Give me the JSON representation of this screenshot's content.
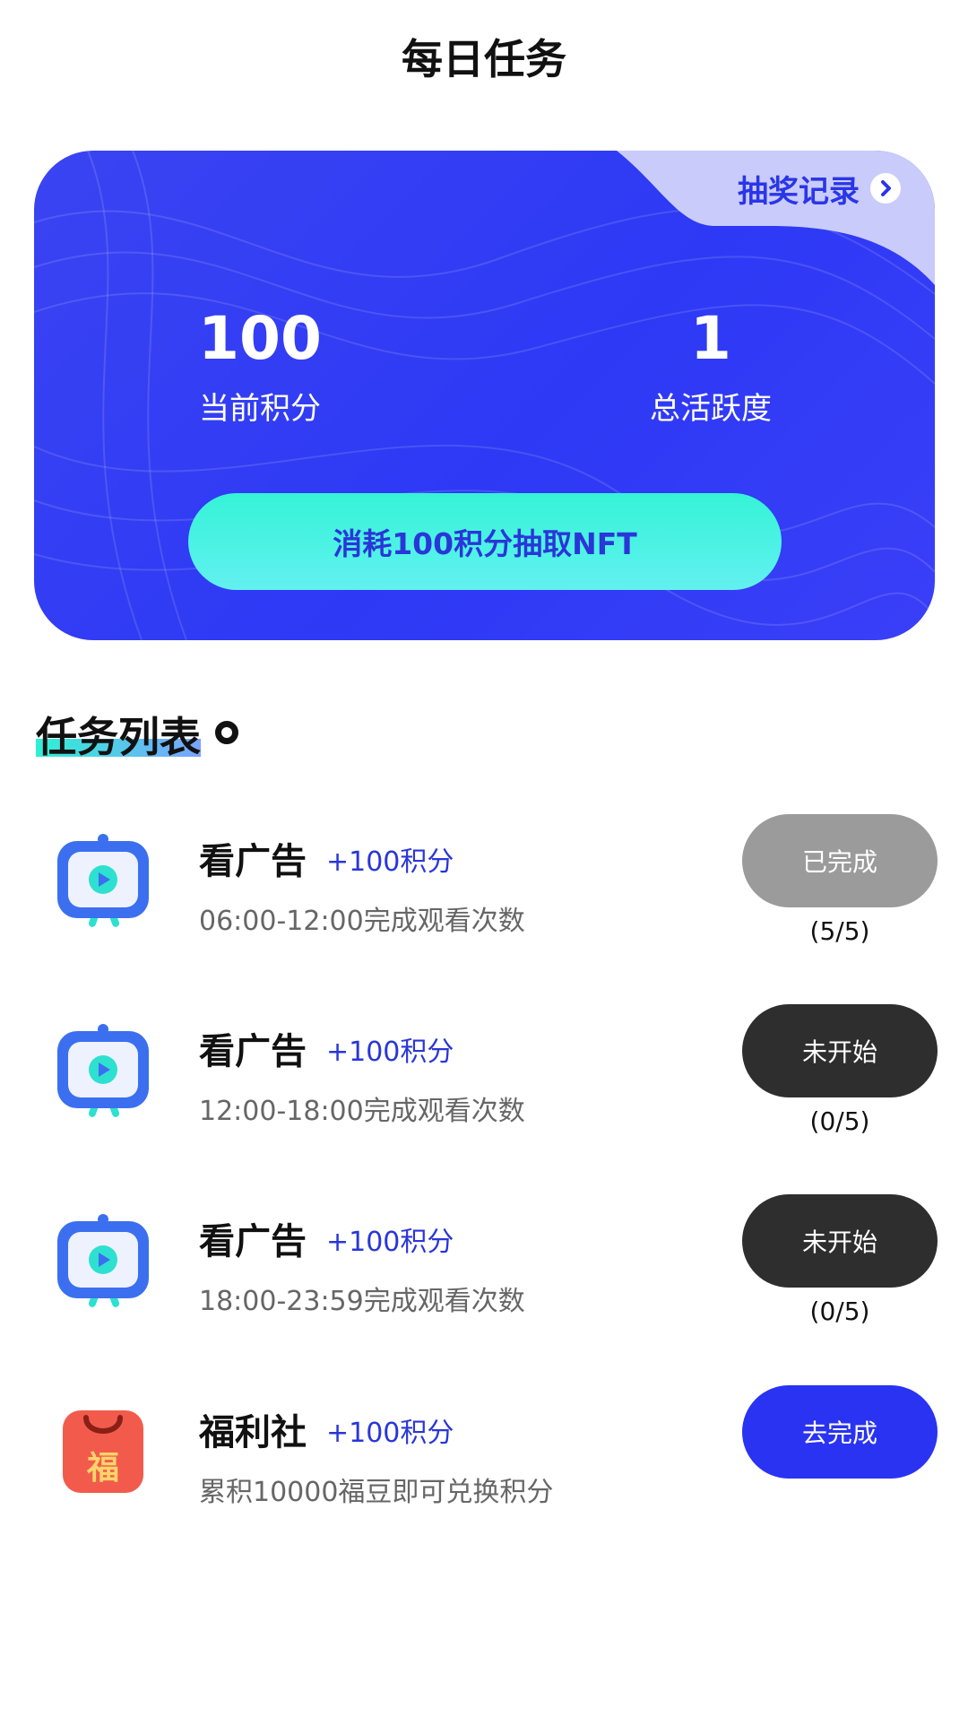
{
  "header": {
    "title": "每日任务"
  },
  "card": {
    "record_label": "抽奖记录",
    "points_value": "100",
    "points_label": "当前积分",
    "activity_value": "1",
    "activity_label": "总活跃度",
    "draw_button_label": "消耗100积分抽取NFT"
  },
  "task_list": {
    "title": "任务列表",
    "tasks": [
      {
        "name": "看广告",
        "points": "+100积分",
        "desc": "06:00-12:00完成观看次数",
        "button": "已完成",
        "progress": "(5/5)",
        "icon": "tv-play-icon"
      },
      {
        "name": "看广告",
        "points": "+100积分",
        "desc": "12:00-18:00完成观看次数",
        "button": "未开始",
        "progress": "(0/5)",
        "icon": "tv-play-icon"
      },
      {
        "name": "看广告",
        "points": "+100积分",
        "desc": "18:00-23:59完成观看次数",
        "button": "未开始",
        "progress": "(0/5)",
        "icon": "tv-play-icon"
      },
      {
        "name": "福利社",
        "points": "+100积分",
        "desc": "累积10000福豆即可兑换积分",
        "button": "去完成",
        "icon": "fu-bag-icon",
        "icon_text": "福"
      }
    ]
  },
  "colors": {
    "card_blue": "#2d39f5",
    "accent_blue": "#2a36d8",
    "done_gray": "#9b9b9b",
    "not_started_dark": "#2e2e2e",
    "go_blue": "#2a33f2",
    "cyan": "#35f3d6"
  }
}
